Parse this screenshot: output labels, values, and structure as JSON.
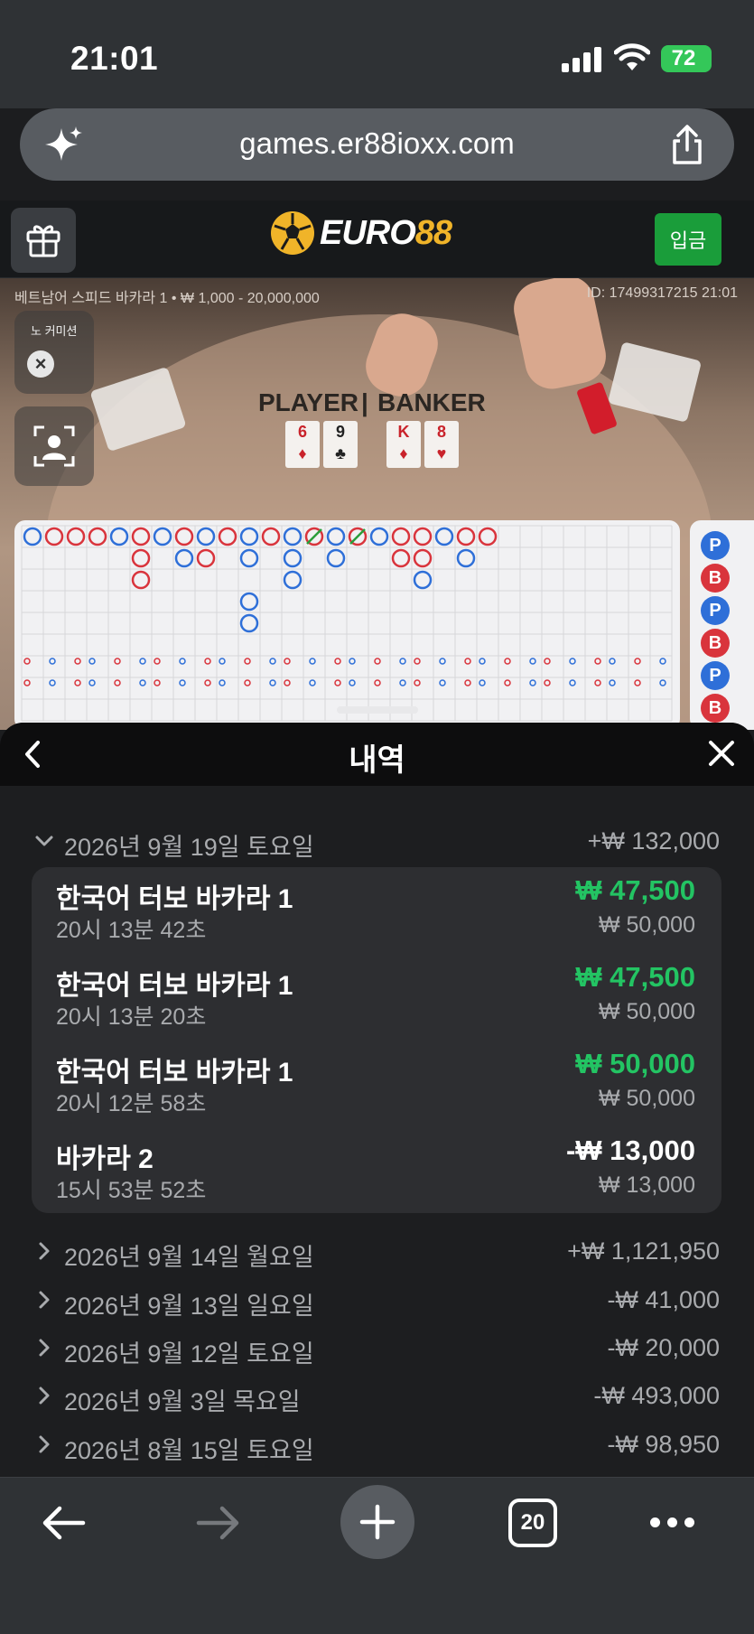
{
  "status_bar": {
    "time": "21:01",
    "battery": "72"
  },
  "browser": {
    "url": "games.er88ioxx.com",
    "tab_count": "20"
  },
  "site": {
    "logo_main": "EURO",
    "logo_accent": "88",
    "deposit_label": "입금"
  },
  "stream": {
    "game_info": "베트남어 스피드 바카라 1 • ₩ 1,000 - 20,000,000",
    "game_id": "ID: 17499317215 21:01",
    "no_commission_label": "노 커미션",
    "player_label": "PLAYER",
    "banker_label": "BANKER",
    "player_cards": [
      {
        "rank": "6",
        "suit": "♦",
        "color": "red"
      },
      {
        "rank": "9",
        "suit": "♣",
        "color": "black"
      }
    ],
    "banker_cards": [
      {
        "rank": "K",
        "suit": "♦",
        "color": "red"
      },
      {
        "rank": "8",
        "suit": "♥",
        "color": "red"
      }
    ]
  },
  "roadmap": {
    "side_badges": [
      "P",
      "B",
      "P",
      "B",
      "P",
      "B"
    ],
    "colors": {
      "player": "#2e6fd8",
      "banker": "#d9343c",
      "tie": "#2a9d3a"
    }
  },
  "history": {
    "title": "내역",
    "expanded_day": {
      "date": "2026년 9월 19일 토요일",
      "total": "+₩ 132,000"
    },
    "bets": [
      {
        "name": "한국어 터보 바카라 1",
        "time": "20시 13분 42초",
        "result": "₩ 47,500",
        "stake": "₩ 50,000",
        "outcome": "win"
      },
      {
        "name": "한국어 터보 바카라 1",
        "time": "20시 13분 20초",
        "result": "₩ 47,500",
        "stake": "₩ 50,000",
        "outcome": "win"
      },
      {
        "name": "한국어 터보 바카라 1",
        "time": "20시 12분 58초",
        "result": "₩ 50,000",
        "stake": "₩ 50,000",
        "outcome": "win"
      },
      {
        "name": "바카라 2",
        "time": "15시 53분 52초",
        "result": "-₩ 13,000",
        "stake": "₩ 13,000",
        "outcome": "loss"
      }
    ],
    "collapsed_days": [
      {
        "date": "2026년 9월 14일 월요일",
        "total": "+₩ 1,121,950"
      },
      {
        "date": "2026년 9월 13일 일요일",
        "total": "-₩ 41,000"
      },
      {
        "date": "2026년 9월 12일 토요일",
        "total": "-₩ 20,000"
      },
      {
        "date": "2026년 9월 3일 목요일",
        "total": "-₩ 493,000"
      },
      {
        "date": "2026년 8월 15일 토요일",
        "total": "-₩ 98,950"
      }
    ]
  },
  "icons": {
    "sparkle": "sparkle-icon",
    "share": "share-icon",
    "gift": "gift-icon",
    "back": "chevron-left-icon",
    "close": "close-icon",
    "nav_back": "arrow-left-icon",
    "nav_forward": "arrow-right-icon",
    "new_tab": "plus-icon",
    "more": "more-icon"
  }
}
